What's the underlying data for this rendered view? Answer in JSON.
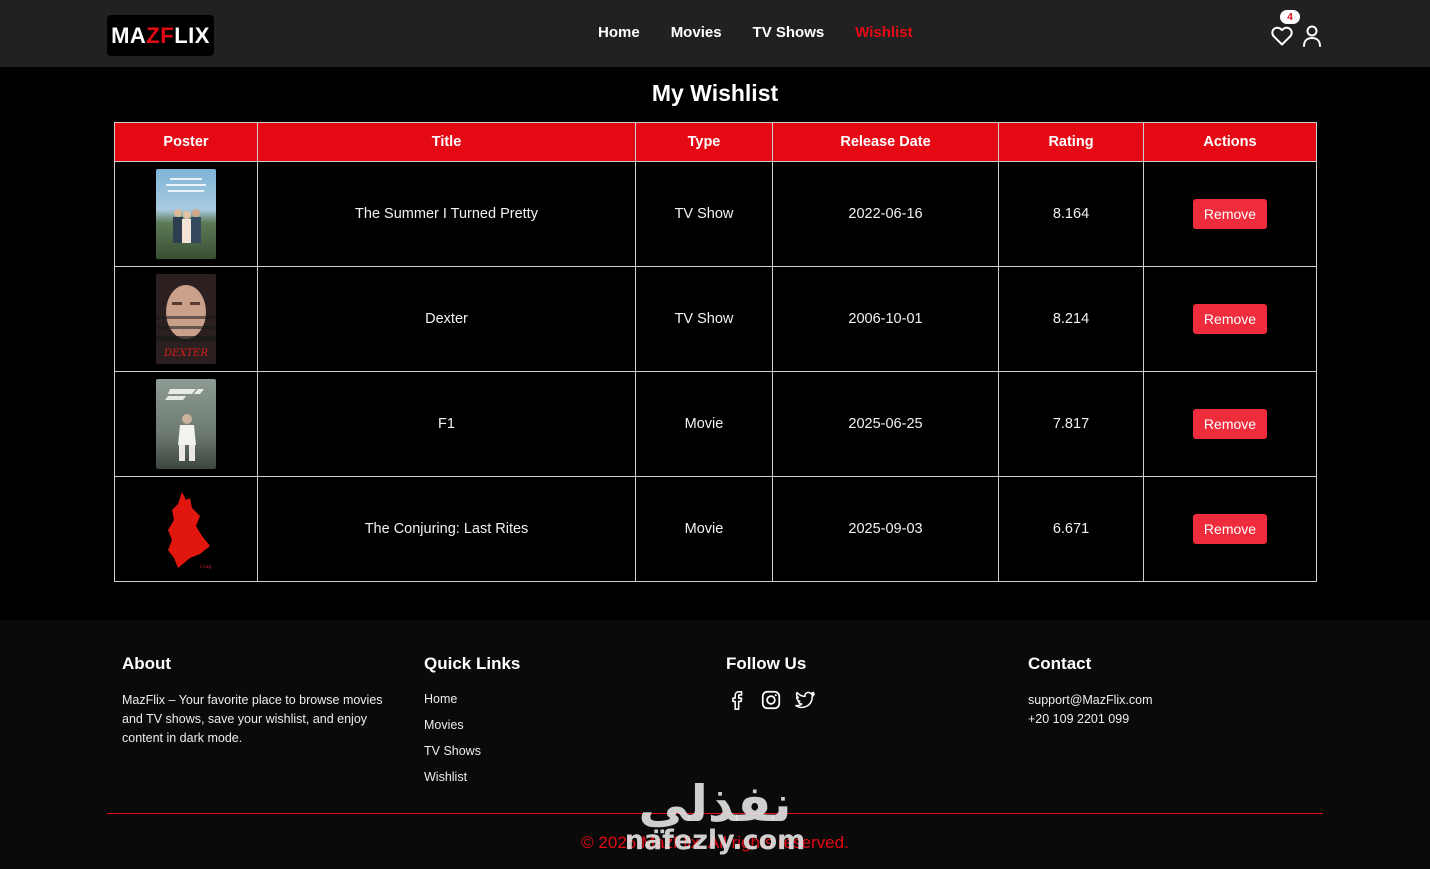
{
  "brand": {
    "logo_left": "MA",
    "logo_mid": "ZF",
    "logo_right": "LIX",
    "accent": "#e50914"
  },
  "nav": {
    "links": [
      {
        "label": "Home",
        "active": false
      },
      {
        "label": "Movies",
        "active": false
      },
      {
        "label": "TV Shows",
        "active": false
      },
      {
        "label": "Wishlist",
        "active": true
      }
    ],
    "wishlist_count": "4",
    "icons": [
      "heart-icon",
      "user-icon"
    ]
  },
  "page": {
    "title": "My Wishlist"
  },
  "table": {
    "headers": [
      "Poster",
      "Title",
      "Type",
      "Release Date",
      "Rating",
      "Actions"
    ],
    "rows": [
      {
        "poster": "summer-poster",
        "title": "The Summer I Turned Pretty",
        "type": "TV Show",
        "release_date": "2022-06-16",
        "rating": "8.164",
        "action": "Remove"
      },
      {
        "poster": "dexter-poster",
        "title": "Dexter",
        "type": "TV Show",
        "release_date": "2006-10-01",
        "rating": "8.214",
        "action": "Remove"
      },
      {
        "poster": "f1-poster",
        "title": "F1",
        "type": "Movie",
        "release_date": "2025-06-25",
        "rating": "7.817",
        "action": "Remove"
      },
      {
        "poster": "conjuring-poster",
        "title": "The Conjuring: Last Rites",
        "type": "Movie",
        "release_date": "2025-09-03",
        "rating": "6.671",
        "action": "Remove"
      }
    ]
  },
  "footer": {
    "about": {
      "heading": "About",
      "text": "MazFlix – Your favorite place to browse movies and TV shows, save your wishlist, and enjoy content in dark mode."
    },
    "quick_links": {
      "heading": "Quick Links",
      "links": [
        "Home",
        "Movies",
        "TV Shows",
        "Wishlist"
      ]
    },
    "follow": {
      "heading": "Follow Us",
      "icons": [
        "facebook-icon",
        "instagram-icon",
        "twitter-icon"
      ]
    },
    "contact": {
      "heading": "Contact",
      "email": "support@MazFlix.com",
      "phone": "+20 109 2201 099"
    },
    "copyright": "© 2025 MazFlix. All rights reserved."
  },
  "watermark": {
    "arabic": "نفذلي",
    "latin": "nafezly.com"
  }
}
